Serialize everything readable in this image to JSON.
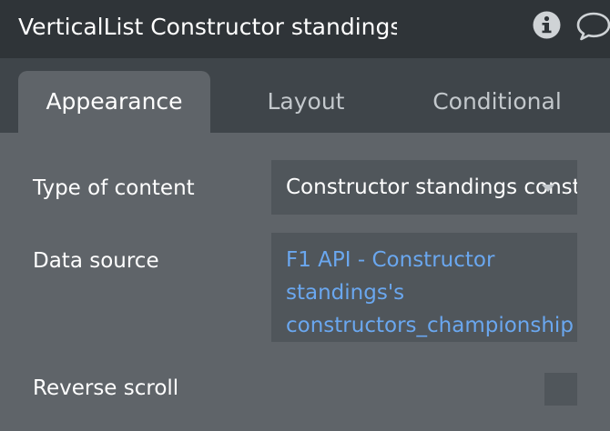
{
  "header": {
    "title": "VerticalList Constructor standings",
    "icons": [
      "info-icon",
      "comment-icon"
    ]
  },
  "tabs": [
    {
      "label": "Appearance",
      "active": true
    },
    {
      "label": "Layout",
      "active": false
    },
    {
      "label": "Conditional",
      "active": false
    }
  ],
  "properties": {
    "type_of_content": {
      "label": "Type of content",
      "value": "Constructor standings constructor"
    },
    "data_source": {
      "label": "Data source",
      "lines": [
        "F1 API - Constructor",
        "standings's",
        "constructors_championship"
      ]
    },
    "reverse_scroll": {
      "label": "Reverse scroll",
      "checked": false
    }
  },
  "colors": {
    "panel_bg": "#5f6469",
    "titlebar_bg": "#2f3438",
    "tabbar_bg": "#3f454a",
    "field_bg": "#50565b",
    "link_blue": "#6aa7ef",
    "inactive_tab_text": "#c3c8cc"
  }
}
